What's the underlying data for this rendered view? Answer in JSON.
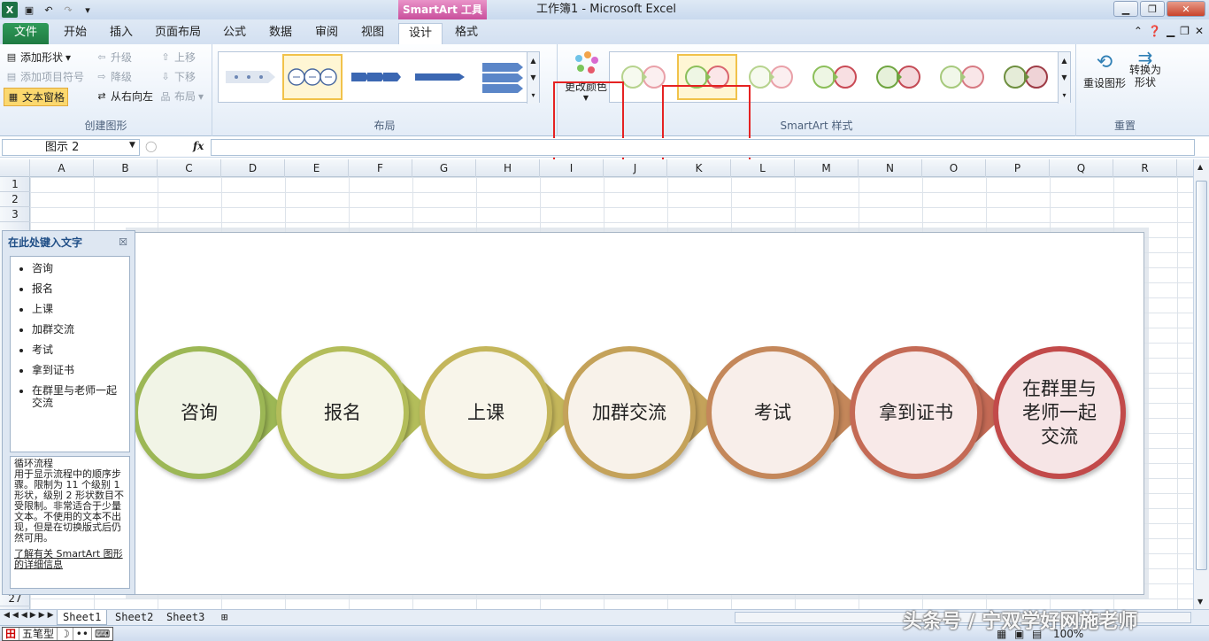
{
  "window": {
    "title": "工作簿1 - Microsoft Excel",
    "context_tab": "SmartArt 工具"
  },
  "tabs": [
    "文件",
    "开始",
    "插入",
    "页面布局",
    "公式",
    "数据",
    "审阅",
    "视图",
    "设计",
    "格式"
  ],
  "ribbon": {
    "create_group": {
      "label": "创建图形",
      "add_shape": "添加形状",
      "add_bullet": "添加项目符号",
      "text_pane": "文本窗格",
      "promote": "升级",
      "demote": "降级",
      "right_to_left": "从右向左",
      "move_up": "上移",
      "move_down": "下移",
      "layout": "布局"
    },
    "layout_group": {
      "label": "布局"
    },
    "styles_group": {
      "label": "SmartArt 样式",
      "change_colors": "更改颜色"
    },
    "reset_group": {
      "label": "重置",
      "reset_graphic": "重设图形",
      "convert_1": "转换为",
      "convert_2": "形状"
    }
  },
  "formula_bar": {
    "name_box": "图示  2",
    "fx": "fx"
  },
  "columns": [
    "A",
    "B",
    "C",
    "D",
    "E",
    "F",
    "G",
    "H",
    "I",
    "J",
    "K",
    "L",
    "M",
    "N",
    "O",
    "P",
    "Q",
    "R"
  ],
  "rows": [
    "1",
    "2",
    "3",
    "27"
  ],
  "text_pane": {
    "title": "在此处键入文字",
    "items": [
      "咨询",
      "报名",
      "上课",
      "加群交流",
      "考试",
      "拿到证书",
      "在群里与老师一起交流"
    ],
    "desc_title": "循环流程",
    "desc_body": "用于显示流程中的顺序步骤。限制为 11 个级别 1 形状，级别 2 形状数目不受限制。非常适合于少量文本。不使用的文本不出现，但是在切换版式后仍然可用。",
    "link": "了解有关 SmartArt 图形的详细信息"
  },
  "diagram": {
    "nodes": [
      {
        "label": "咨询",
        "border": "#9cb755",
        "fill": "#f1f4e6"
      },
      {
        "label": "报名",
        "border": "#b3bd5a",
        "fill": "#f6f6e8"
      },
      {
        "label": "上课",
        "border": "#c4b65b",
        "fill": "#f8f5ea"
      },
      {
        "label": "加群交流",
        "border": "#c4a25a",
        "fill": "#f8f2ea"
      },
      {
        "label": "考试",
        "border": "#c4875a",
        "fill": "#f8eeea"
      },
      {
        "label": "拿到证书",
        "border": "#c46a55",
        "fill": "#f8e9e8"
      },
      {
        "label": "在群里与老师一起交流",
        "border": "#c24a4a",
        "fill": "#f6e5e6"
      }
    ]
  },
  "sheets": [
    "Sheet1",
    "Sheet2",
    "Sheet3"
  ],
  "status": {
    "ime_name": "五笔型",
    "zoom": "100%"
  },
  "watermark": "头条号 / 宁双学好网施老师"
}
